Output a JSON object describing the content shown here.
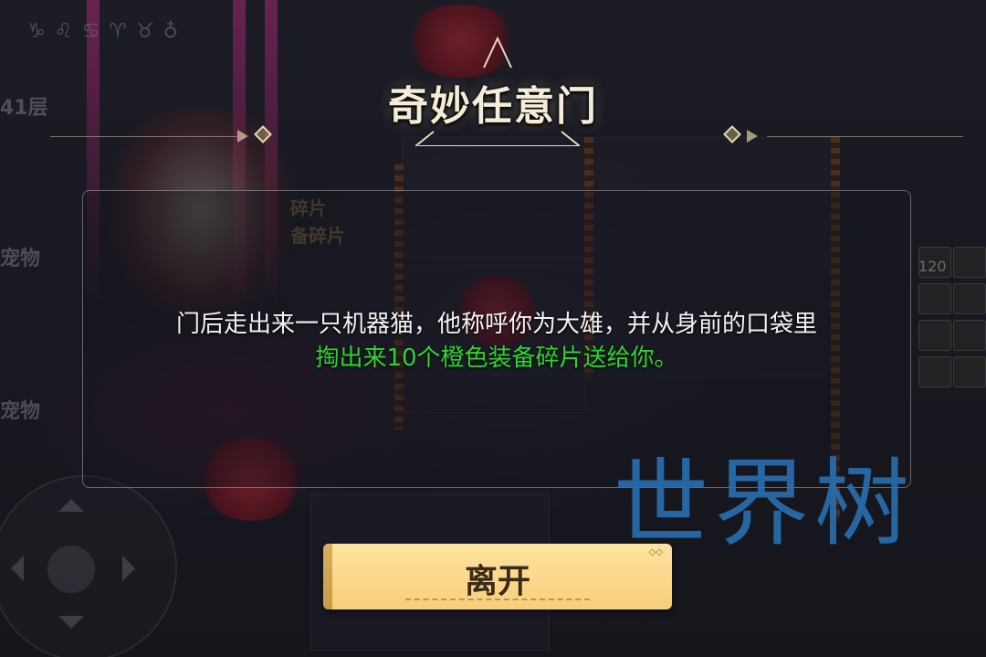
{
  "background": {
    "floor_label": "41层",
    "side_labels": [
      "宠物",
      "宠物"
    ],
    "item_texts": [
      "碎片",
      "备碎片"
    ],
    "right_count": "120",
    "zodiac_symbols": "♑♌♋♈♉♁"
  },
  "dialog": {
    "title": "奇妙任意门",
    "message_line1": "门后走出来一只机器猫，他称呼你为大雄，并从身前的口袋里",
    "message_line2": "掏出来10个橙色装备碎片送给你。",
    "leave_label": "离开"
  },
  "watermark": "世界树",
  "colors": {
    "message_white": "#f2f2f2",
    "message_green": "#2fd32f",
    "button_fill": "#f8cf7a",
    "watermark_blue": "#286eaf"
  }
}
